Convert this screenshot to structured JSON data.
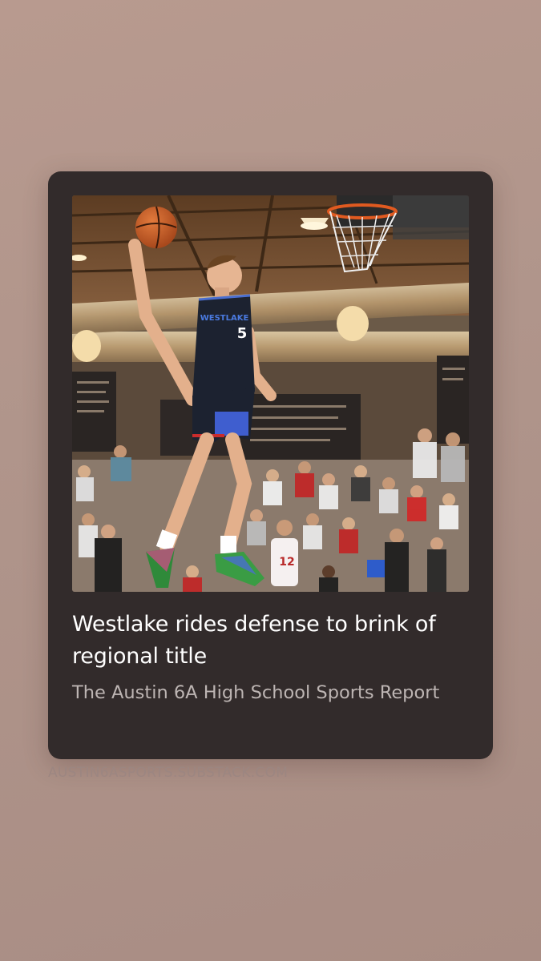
{
  "card": {
    "image_alt": "Basketball player dunking in a crowded gym",
    "title": "Westlake rides defense to brink of regional title",
    "publication": "The Austin 6A High School Sports Report"
  },
  "footer": {
    "domain": "AUSTIN6ASPORTS.SUBSTACK.COM"
  },
  "photo": {
    "jersey_name": "WESTLAKE",
    "jersey_number": "5",
    "opponent_number": "12"
  },
  "colors": {
    "background": "#b49890",
    "card": "#322b2b",
    "title": "#ffffff",
    "publication": "#bdb5b3",
    "domain": "#9c8681"
  }
}
